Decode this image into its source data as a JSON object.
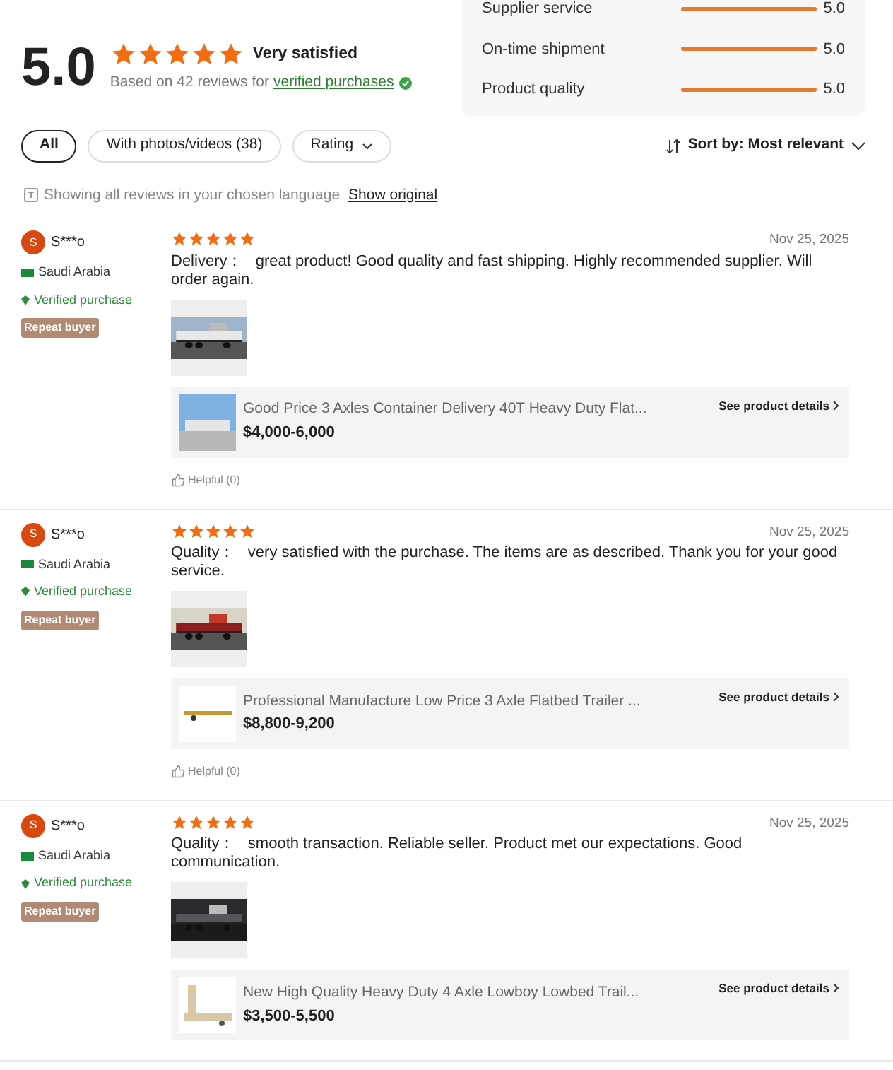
{
  "summary": {
    "score": "5.0",
    "stars": 5,
    "label": "Very satisfied",
    "based_on": "Based on 42 reviews for",
    "link": "verified purchases"
  },
  "ratings": [
    {
      "name": "Supplier service",
      "level": 1.0,
      "value": "5.0"
    },
    {
      "name": "On-time shipment",
      "level": 1.0,
      "value": "5.0"
    },
    {
      "name": "Product quality",
      "level": 1.0,
      "value": "5.0"
    }
  ],
  "filters": [
    {
      "label": "All",
      "selected": true,
      "kind": "plain"
    },
    {
      "label": "With photos/videos (38)",
      "selected": false,
      "kind": "plain"
    },
    {
      "label": "Rating",
      "selected": false,
      "kind": "dropdown"
    }
  ],
  "sort": "Sort by: Most relevant",
  "language_note": {
    "text": "Showing all reviews in your chosen language",
    "link": "Show original"
  },
  "reviews": [
    {
      "initial": "S",
      "name": "S***o",
      "country": "Saudi Arabia",
      "verified": "Verified purchase",
      "badge": "Repeat buyer",
      "stars": 5,
      "date": "Nov 25, 2025",
      "topic": "Delivery：",
      "text": "great product! Good quality and fast shipping. Highly recommended supplier. Will order again.",
      "product": {
        "title": "Good Price 3 Axles Container Delivery 40T Heavy Duty Flat...",
        "price": "$4,000-6,000",
        "link": "See product details"
      },
      "helpful": "Helpful (0)"
    },
    {
      "initial": "S",
      "name": "S***o",
      "country": "Saudi Arabia",
      "verified": "Verified purchase",
      "badge": "Repeat buyer",
      "stars": 5,
      "date": "Nov 25, 2025",
      "topic": "Quality：",
      "text": "very satisfied with the purchase. The items are as described. Thank you for your good service.",
      "product": {
        "title": "Professional Manufacture Low Price 3 Axle Flatbed Trailer ...",
        "price": "$8,800-9,200",
        "link": "See product details"
      },
      "helpful": "Helpful (0)"
    },
    {
      "initial": "S",
      "name": "S***o",
      "country": "Saudi Arabia",
      "verified": "Verified purchase",
      "badge": "Repeat buyer",
      "stars": 5,
      "date": "Nov 25, 2025",
      "topic": "Quality：",
      "text": "smooth transaction. Reliable seller. Product met our expectations. Good communication.",
      "product": {
        "title": "New High Quality Heavy Duty 4 Axle Lowboy Lowbed Trail...",
        "price": "$3,500-5,500",
        "link": "See product details"
      }
    }
  ]
}
